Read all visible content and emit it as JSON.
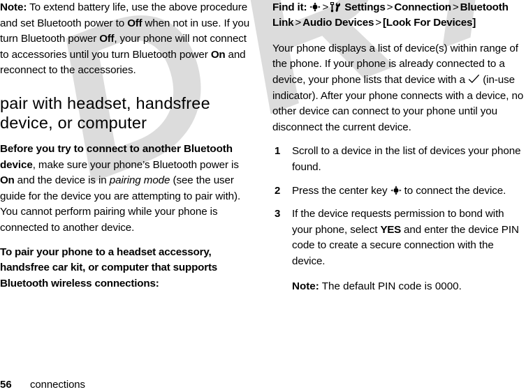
{
  "watermark": {
    "text": "DRAFT",
    "color": "#dcdcdc"
  },
  "footer": {
    "page_number": "56",
    "chapter": "connections"
  },
  "left_column": {
    "note_paragraph": {
      "label": "Note:",
      "text_1": " To extend battery life, use the above procedure and set Bluetooth power to ",
      "term_1": "Off",
      "text_2": " when not in use. If you turn Bluetooth power ",
      "term_2": "Off",
      "text_3": ", your phone will not connect to accessories until you turn Bluetooth power ",
      "term_3": "On",
      "text_4": " and reconnect to the accessories."
    },
    "section_heading": "pair with headset, handsfree device, or computer",
    "before_paragraph": {
      "lead": "Before you try to connect to another Bluetooth device",
      "text_1": ", make sure your phone’s Bluetooth power is ",
      "term_1": "On",
      "text_2": " and the device is in ",
      "italic_1": "pairing mode",
      "text_3": " (see the user guide for the device you are attempting to pair with). You cannot perform pairing while your phone is connected to another device."
    },
    "to_pair_paragraph": "To pair your phone to a headset accessory, handsfree car kit, or computer that supports Bluetooth wireless connections:"
  },
  "right_column": {
    "find_it": {
      "label": "Find it:",
      "icon_1": "center-key-icon",
      "separator": ">",
      "icon_2": "settings-tools-icon",
      "step_1": "Settings",
      "step_2": "Connection",
      "step_3": "Bluetooth Link",
      "step_4": "Audio Devices",
      "step_5": "[Look For Devices]"
    },
    "intro_paragraph": {
      "text_1": "Your phone displays a list of device(s) within range of the phone. If your phone is already connected to a device, your phone lists that device with a ",
      "icon": "checkmark-icon",
      "text_2": " (in-use indicator). After your phone connects with a device, no other device can connect to your phone until you disconnect the current device."
    },
    "steps": [
      {
        "number": "1",
        "text": "Scroll to a device in the list of devices your phone found."
      },
      {
        "number": "2",
        "text_1": "Press the center key ",
        "icon": "center-key-icon",
        "text_2": " to connect the device."
      },
      {
        "number": "3",
        "text_1": "If the device requests permission to bond with your phone, select ",
        "term_1": "YES",
        "text_2": " and enter the device PIN code to create a secure connection with the device."
      }
    ],
    "final_note": {
      "label": "Note:",
      "text": " The default PIN code is 0000."
    }
  }
}
